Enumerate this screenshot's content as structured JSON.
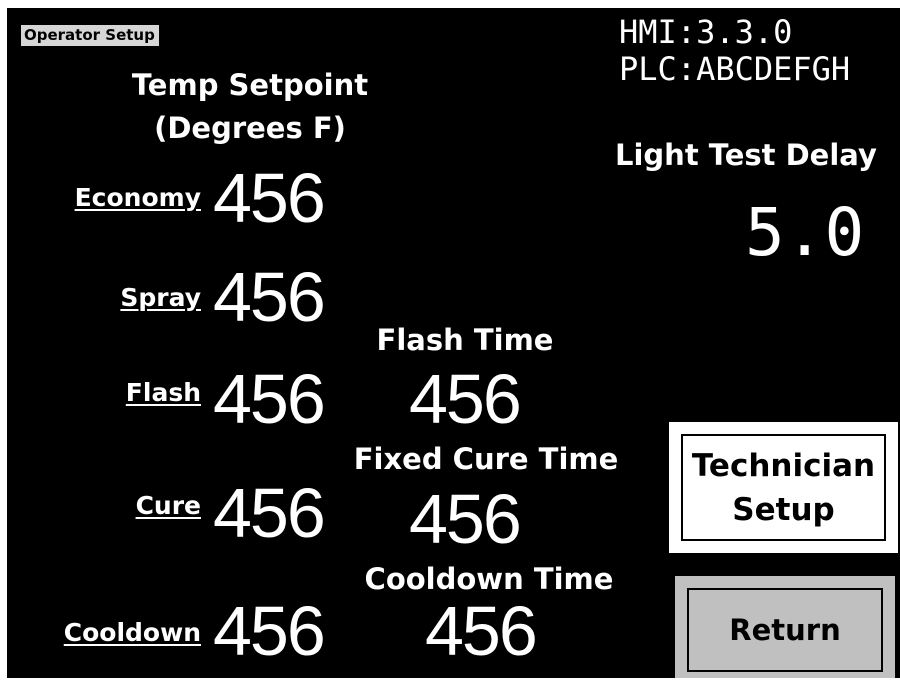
{
  "screen": {
    "title": "Operator Setup",
    "hmi_version": "HMI:3.3.0",
    "plc_version": "PLC:ABCDEFGH",
    "colors": {
      "background": "#000000",
      "text": "#ffffff",
      "title_tag": "#d6d6d6",
      "technician_button": "#ffffff",
      "return_button": "#c0c0c0"
    }
  },
  "temp_setpoint": {
    "heading_line1": "Temp Setpoint",
    "heading_line2": "(Degrees F)",
    "zones": [
      {
        "label": "Economy",
        "value": "456"
      },
      {
        "label": "Spray",
        "value": "456"
      },
      {
        "label": "Flash",
        "value": "456"
      },
      {
        "label": "Cure",
        "value": "456"
      },
      {
        "label": "Cooldown",
        "value": "456"
      }
    ]
  },
  "times": {
    "flash_time": {
      "label": "Flash Time",
      "value": "456"
    },
    "fixed_cure_time": {
      "label": "Fixed Cure Time",
      "value": "456"
    },
    "cooldown_time": {
      "label": "Cooldown Time",
      "value": "456"
    }
  },
  "light_test": {
    "label": "Light Test Delay",
    "value": "5.0"
  },
  "buttons": {
    "technician_setup": "Technician\nSetup",
    "return": "Return"
  }
}
